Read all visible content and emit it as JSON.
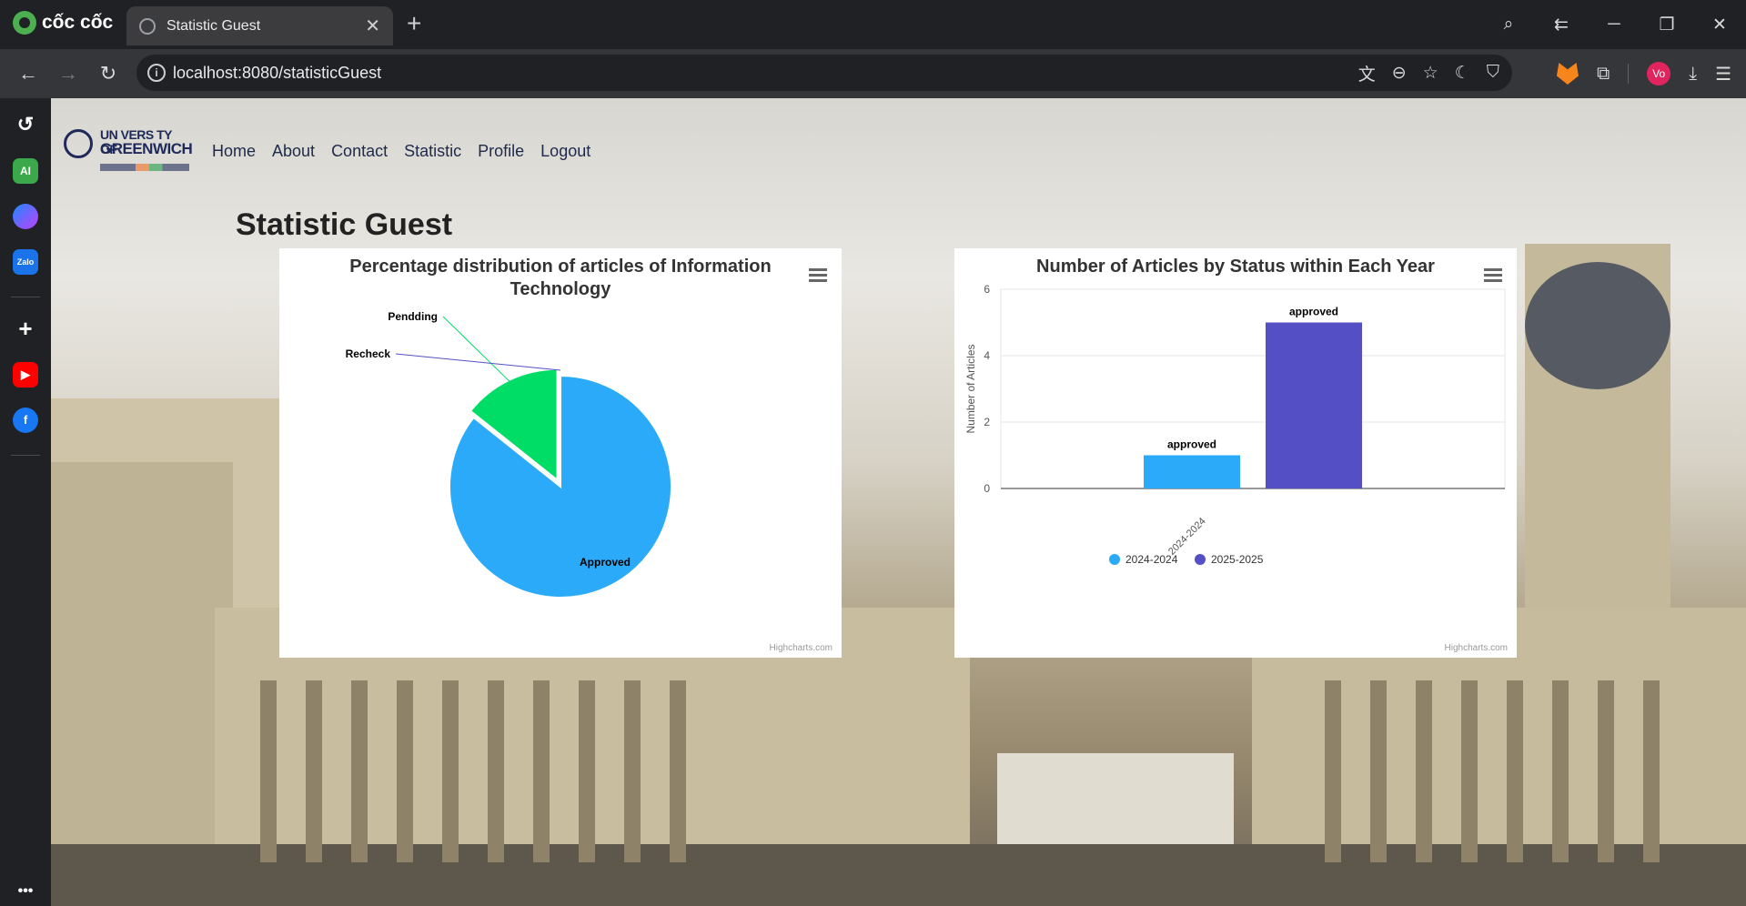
{
  "browser": {
    "brand": "cốc cốc",
    "tab_title": "Statistic Guest",
    "url": "localhost:8080/statisticGuest",
    "profile_initials": "Vo",
    "sidebar_ai_label": "AI",
    "sidebar_zalo_label": "Zalo"
  },
  "site": {
    "logo_line1": "UN VERS TY OF",
    "logo_line2": "GREENWICH",
    "nav": [
      "Home",
      "About",
      "Contact",
      "Statistic",
      "Profile",
      "Logout"
    ],
    "page_title": "Statistic Guest"
  },
  "chart_data": [
    {
      "type": "pie",
      "title": "Percentage distribution of articles of Information Technology",
      "slices": [
        {
          "name": "Approved",
          "value": 85.7,
          "color": "#2aaaf8"
        },
        {
          "name": "Pendding",
          "value": 14.3,
          "color": "#00dd66"
        },
        {
          "name": "Recheck",
          "value": 0,
          "color": "#544fc5"
        }
      ],
      "credits": "Highcharts.com"
    },
    {
      "type": "bar",
      "title": "Number of Articles by Status within Each Year",
      "ylabel": "Number of Articles",
      "ylim": [
        0,
        6
      ],
      "yticks": [
        0,
        2,
        4,
        6
      ],
      "categories": [
        "2024-2024"
      ],
      "series": [
        {
          "name": "2024-2024",
          "values": [
            1
          ],
          "color": "#2aaaf8",
          "data_label": "approved"
        },
        {
          "name": "2025-2025",
          "values": [
            5
          ],
          "color": "#544fc5",
          "data_label": "approved"
        }
      ],
      "grid": true,
      "legend": "bottom-center",
      "credits": "Highcharts.com"
    }
  ]
}
